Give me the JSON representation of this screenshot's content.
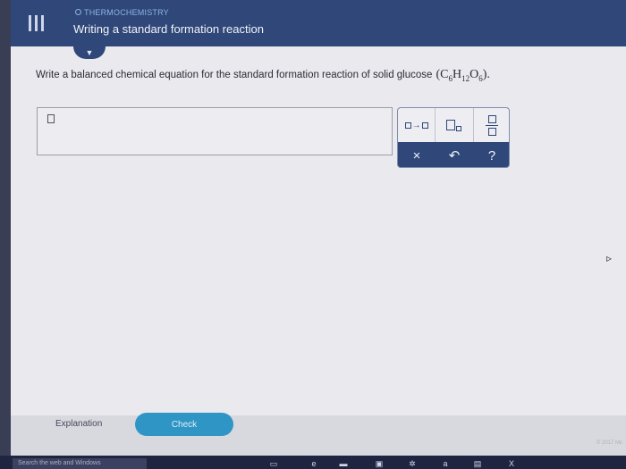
{
  "header": {
    "crumb": "THERMOCHEMISTRY",
    "crumb_icon": "circle-outline-icon",
    "title": "Writing a standard formation reaction",
    "menu_icon": "hamburger-menu-icon",
    "color": "#2f4779"
  },
  "question": {
    "text": "Write a balanced chemical equation for the standard formation reaction of solid glucose",
    "formula_open": "(",
    "formula_c": "C",
    "formula_c_sub": "6",
    "formula_h": "H",
    "formula_h_sub": "12",
    "formula_o": "O",
    "formula_o_sub": "6",
    "formula_close": ").",
    "dropdown_icon": "chevron-down-icon"
  },
  "toolbar": {
    "row1": [
      "reaction-arrow-template-icon",
      "subscript-template-icon",
      "fraction-template-icon"
    ],
    "clear_label": "×",
    "undo_label": "↶",
    "help_label": "?",
    "arrow_glyph": "→"
  },
  "footer": {
    "explanation_label": "Explanation",
    "check_label": "Check",
    "copyright": "© 2017 Mc",
    "accent": "#2f95c4"
  },
  "taskbar": {
    "search_placeholder": "Search the web and Windows"
  }
}
